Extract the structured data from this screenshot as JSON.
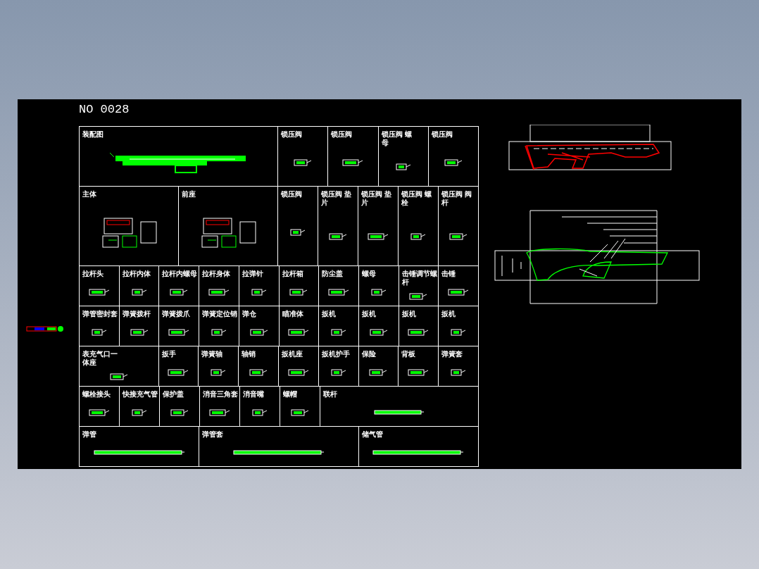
{
  "canvas": {
    "title": "NO 0028",
    "sheet": {
      "bands": [
        {
          "panels": [
            {
              "label": "装配图"
            },
            {
              "label": "锁压阀"
            },
            {
              "label": "锁压阀"
            },
            {
              "label": "锁压阀 螺母"
            },
            {
              "label": "锁压阀"
            }
          ]
        },
        {
          "panels": [
            {
              "label": "主体"
            },
            {
              "label": "前座"
            },
            {
              "label": "锁压阀"
            },
            {
              "label": "锁压阀 垫片"
            },
            {
              "label": "锁压阀 垫片"
            },
            {
              "label": "锁压阀 螺栓"
            },
            {
              "label": "锁压阀 阀杆"
            }
          ]
        },
        {
          "panels": [
            {
              "label": "拉杆头"
            },
            {
              "label": "拉杆内体"
            },
            {
              "label": "拉杆内螺母"
            },
            {
              "label": "拉杆身体"
            },
            {
              "label": "拉弹针"
            },
            {
              "label": "拉杆箱"
            },
            {
              "label": "防尘盖"
            },
            {
              "label": "螺母"
            },
            {
              "label": "击锤调节螺杆"
            },
            {
              "label": "击锤"
            }
          ]
        },
        {
          "panels": [
            {
              "label": "弹管密封套"
            },
            {
              "label": "弹簧拨杆"
            },
            {
              "label": "弹簧拨爪"
            },
            {
              "label": "弹簧定位销"
            },
            {
              "label": "弹仓"
            },
            {
              "label": "瞄准体"
            },
            {
              "label": "扳机"
            },
            {
              "label": "扳机"
            },
            {
              "label": "扳机"
            },
            {
              "label": "扳机"
            }
          ]
        },
        {
          "panels": [
            {
              "label": "表充气口一体座"
            },
            {
              "label": "扳手"
            },
            {
              "label": "弹簧轴"
            },
            {
              "label": "轴销"
            },
            {
              "label": "扳机座"
            },
            {
              "label": "扳机护手"
            },
            {
              "label": "保险"
            },
            {
              "label": "背板"
            },
            {
              "label": "弹簧套"
            }
          ]
        },
        {
          "panels": [
            {
              "label": "螺栓接头"
            },
            {
              "label": "快接充气管"
            },
            {
              "label": "保护盖"
            },
            {
              "label": "消音三角套"
            },
            {
              "label": "消音嘴"
            },
            {
              "label": "螺帽"
            },
            {
              "label": "联杆"
            }
          ]
        },
        {
          "panels": [
            {
              "label": "弹管"
            },
            {
              "label": "弹管套"
            },
            {
              "label": "储气管"
            }
          ]
        }
      ]
    }
  }
}
